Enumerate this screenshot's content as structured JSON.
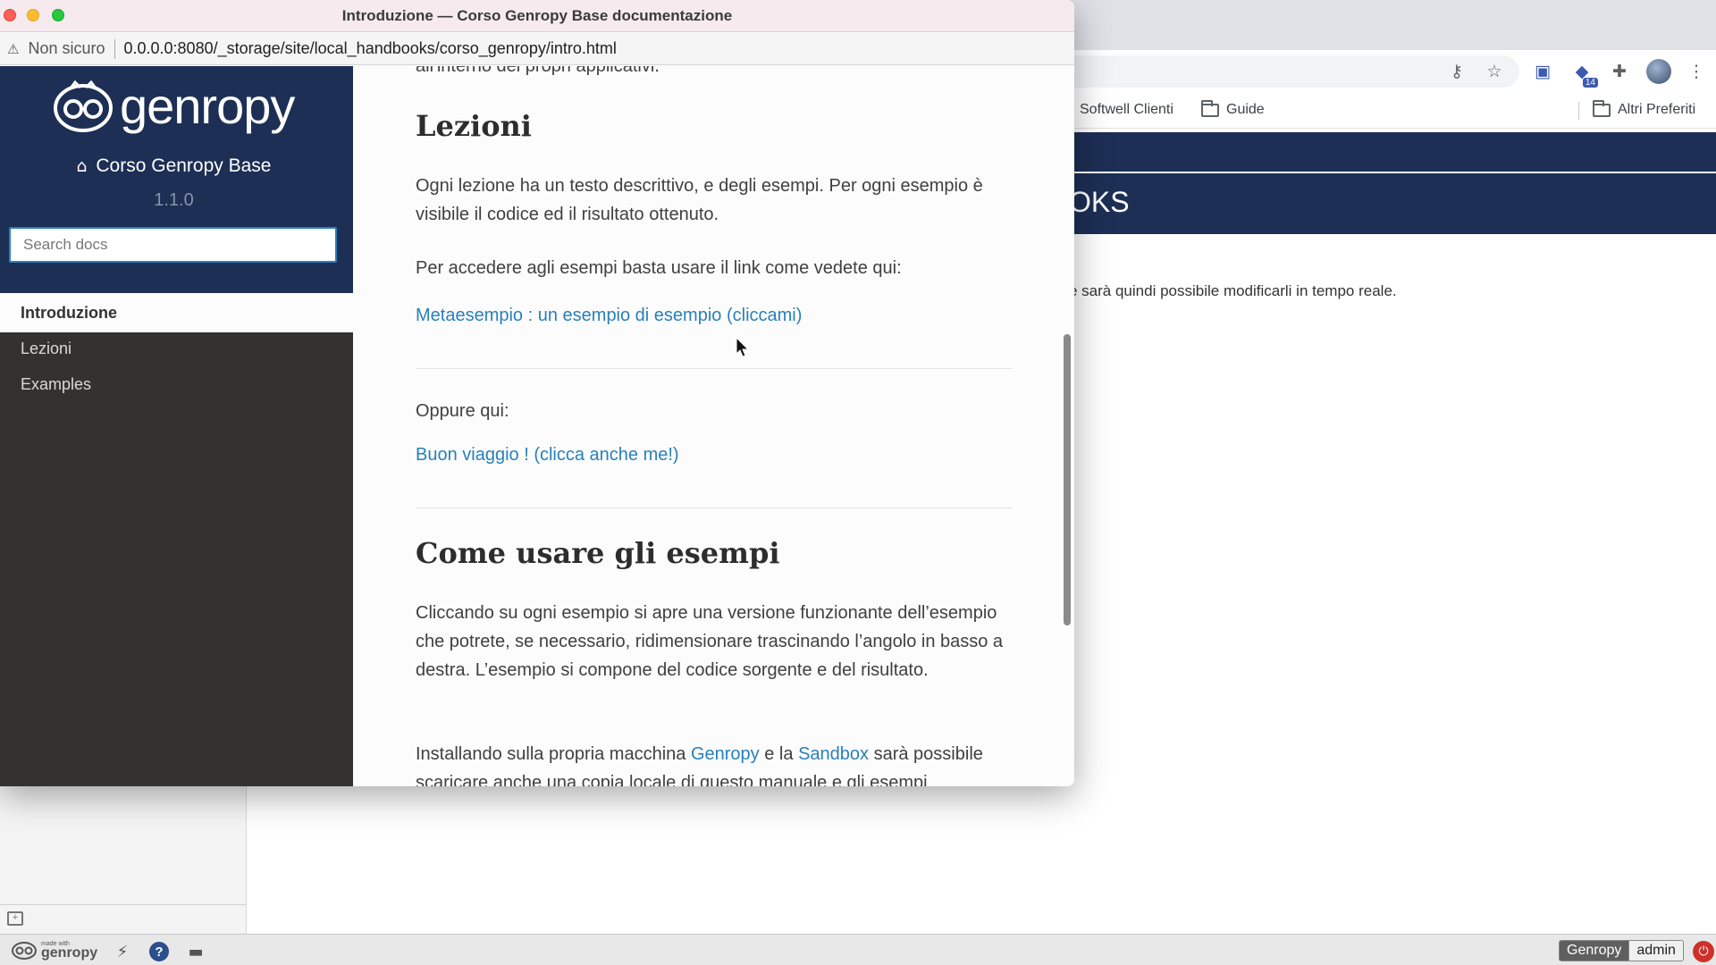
{
  "window": {
    "title": "Introduzione — Corso Genropy Base documentazione",
    "security_label": "Non sicuro",
    "url": "0.0.0.0:8080/_storage/site/local_handbooks/corso_genropy/intro.html"
  },
  "sidebar": {
    "logo_text": "genropy",
    "project_name": "Corso Genropy Base",
    "version": "1.1.0",
    "search_placeholder": "Search docs",
    "nav": [
      {
        "label": "Introduzione"
      },
      {
        "label": "Lezioni"
      },
      {
        "label": "Examples"
      }
    ]
  },
  "content": {
    "top_cut_text": "all'interno dei propri applicativi.",
    "lezioni_heading": "Lezioni",
    "lezioni_p1": "Ogni lezione ha un testo descrittivo, e degli esempi. Per ogni esempio è visibile il codice ed il risultato ottenuto.",
    "lezioni_p2": "Per accedere agli esempi basta usare il link come vedete qui:",
    "link1": "Metaesempio : un esempio di esempio (cliccami)",
    "oppure": "Oppure qui:",
    "link2": "Buon viaggio ! (clicca anche me!)",
    "come_heading": "Come usare gli esempi",
    "come_p1": "Cliccando su ogni esempio si apre una versione funzionante dell’esempio che potrete, se necessario, ridimensionare trascinando l’angolo in basso a destra. L’esempio si compone del codice sorgente e del risultato.",
    "install_pre": "Installando sulla propria macchina",
    "install_link1": "Genropy",
    "install_mid": "e la",
    "install_link2": "Sandbox",
    "install_post": "sarà possibile",
    "bottom_cut_text": "scaricare anche una copia locale di questo manuale e gli esempi"
  },
  "background_browser": {
    "bookmarks": [
      {
        "label": "Softwell Clienti"
      },
      {
        "label": "Guide"
      },
      {
        "label": "Altri Preferiti"
      }
    ],
    "header_title": "OKS",
    "body_text": "e sarà quindi possibile modificarli in tempo reale.",
    "toolbar_icons": [
      "key-icon",
      "star-icon",
      "extension-icon",
      "extension-badge-icon",
      "puzzle-icon",
      "avatar",
      "more-icon"
    ],
    "extension_badge": "14"
  },
  "statusbar": {
    "made_with": "made with",
    "logo": "genropy",
    "app_name": "Genropy",
    "username": "admin"
  },
  "colors": {
    "sidebar_header": "#1d2f55",
    "sidebar_body": "#343131",
    "link": "#2980b9",
    "search_border": "#2980b9"
  }
}
